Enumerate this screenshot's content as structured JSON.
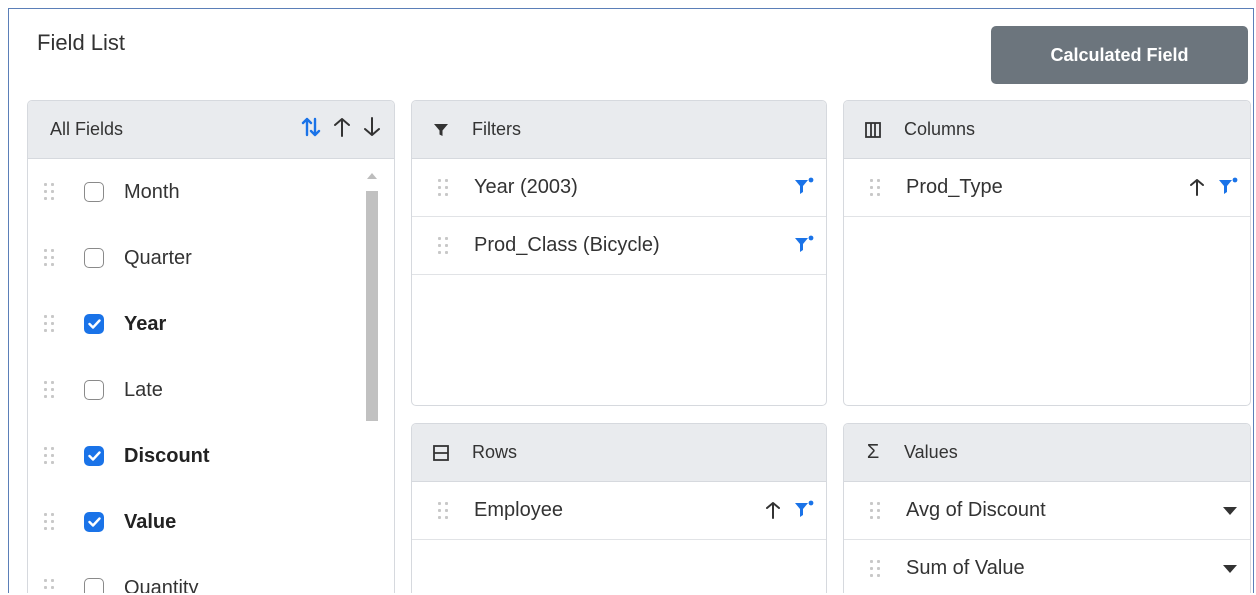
{
  "header": {
    "title": "Field List",
    "calculated_field_label": "Calculated Field"
  },
  "all_fields": {
    "title": "All Fields",
    "sort_icons": [
      "sort-toggle-icon",
      "sort-ascending-icon",
      "sort-descending-icon"
    ],
    "items": [
      {
        "label": "Month",
        "checked": false
      },
      {
        "label": "Quarter",
        "checked": false
      },
      {
        "label": "Year",
        "checked": true
      },
      {
        "label": "Late",
        "checked": false
      },
      {
        "label": "Discount",
        "checked": true
      },
      {
        "label": "Value",
        "checked": true
      },
      {
        "label": "Quantity",
        "checked": false
      }
    ]
  },
  "filters": {
    "title": "Filters",
    "icon": "filter-icon",
    "items": [
      {
        "label": "Year (2003)"
      },
      {
        "label": "Prod_Class (Bicycle)"
      }
    ]
  },
  "columns": {
    "title": "Columns",
    "icon": "columns-icon",
    "items": [
      {
        "label": "Prod_Type"
      }
    ]
  },
  "rows": {
    "title": "Rows",
    "icon": "rows-icon",
    "items": [
      {
        "label": "Employee"
      }
    ]
  },
  "values": {
    "title": "Values",
    "icon": "sigma-icon",
    "items": [
      {
        "label": "Avg of Discount"
      },
      {
        "label": "Sum of Value"
      }
    ]
  },
  "colors": {
    "accent": "#1a73e8",
    "button": "#6c757d",
    "panel_header": "#e9ebee",
    "frame_border": "#5b7fb8"
  }
}
